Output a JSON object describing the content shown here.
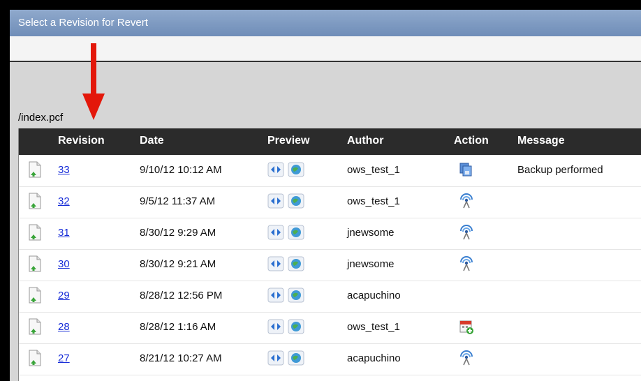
{
  "dialog": {
    "title": "Select a Revision for Revert"
  },
  "file_path": "/index.pcf",
  "columns": [
    "Revision",
    "Date",
    "Preview",
    "Author",
    "Action",
    "Message"
  ],
  "rows": [
    {
      "revision": "33",
      "date": "9/10/12 10:12 AM",
      "author": "ows_test_1",
      "action_icon": "backup-icon",
      "message": "Backup performed"
    },
    {
      "revision": "32",
      "date": "9/5/12 11:37 AM",
      "author": "ows_test_1",
      "action_icon": "publish-icon",
      "message": ""
    },
    {
      "revision": "31",
      "date": "8/30/12 9:29 AM",
      "author": "jnewsome",
      "action_icon": "publish-icon",
      "message": ""
    },
    {
      "revision": "30",
      "date": "8/30/12 9:21 AM",
      "author": "jnewsome",
      "action_icon": "publish-icon",
      "message": ""
    },
    {
      "revision": "29",
      "date": "8/28/12 12:56 PM",
      "author": "acapuchino",
      "action_icon": "",
      "message": ""
    },
    {
      "revision": "28",
      "date": "8/28/12 1:16 AM",
      "author": "ows_test_1",
      "action_icon": "schedule-icon",
      "message": ""
    },
    {
      "revision": "27",
      "date": "8/21/12 10:27 AM",
      "author": "acapuchino",
      "action_icon": "publish-icon",
      "message": ""
    }
  ],
  "colors": {
    "header_bg": "#2b2b2b",
    "title_bar": "#7f9bc2",
    "link": "#1a2fd8",
    "arrow": "#e3170a"
  }
}
